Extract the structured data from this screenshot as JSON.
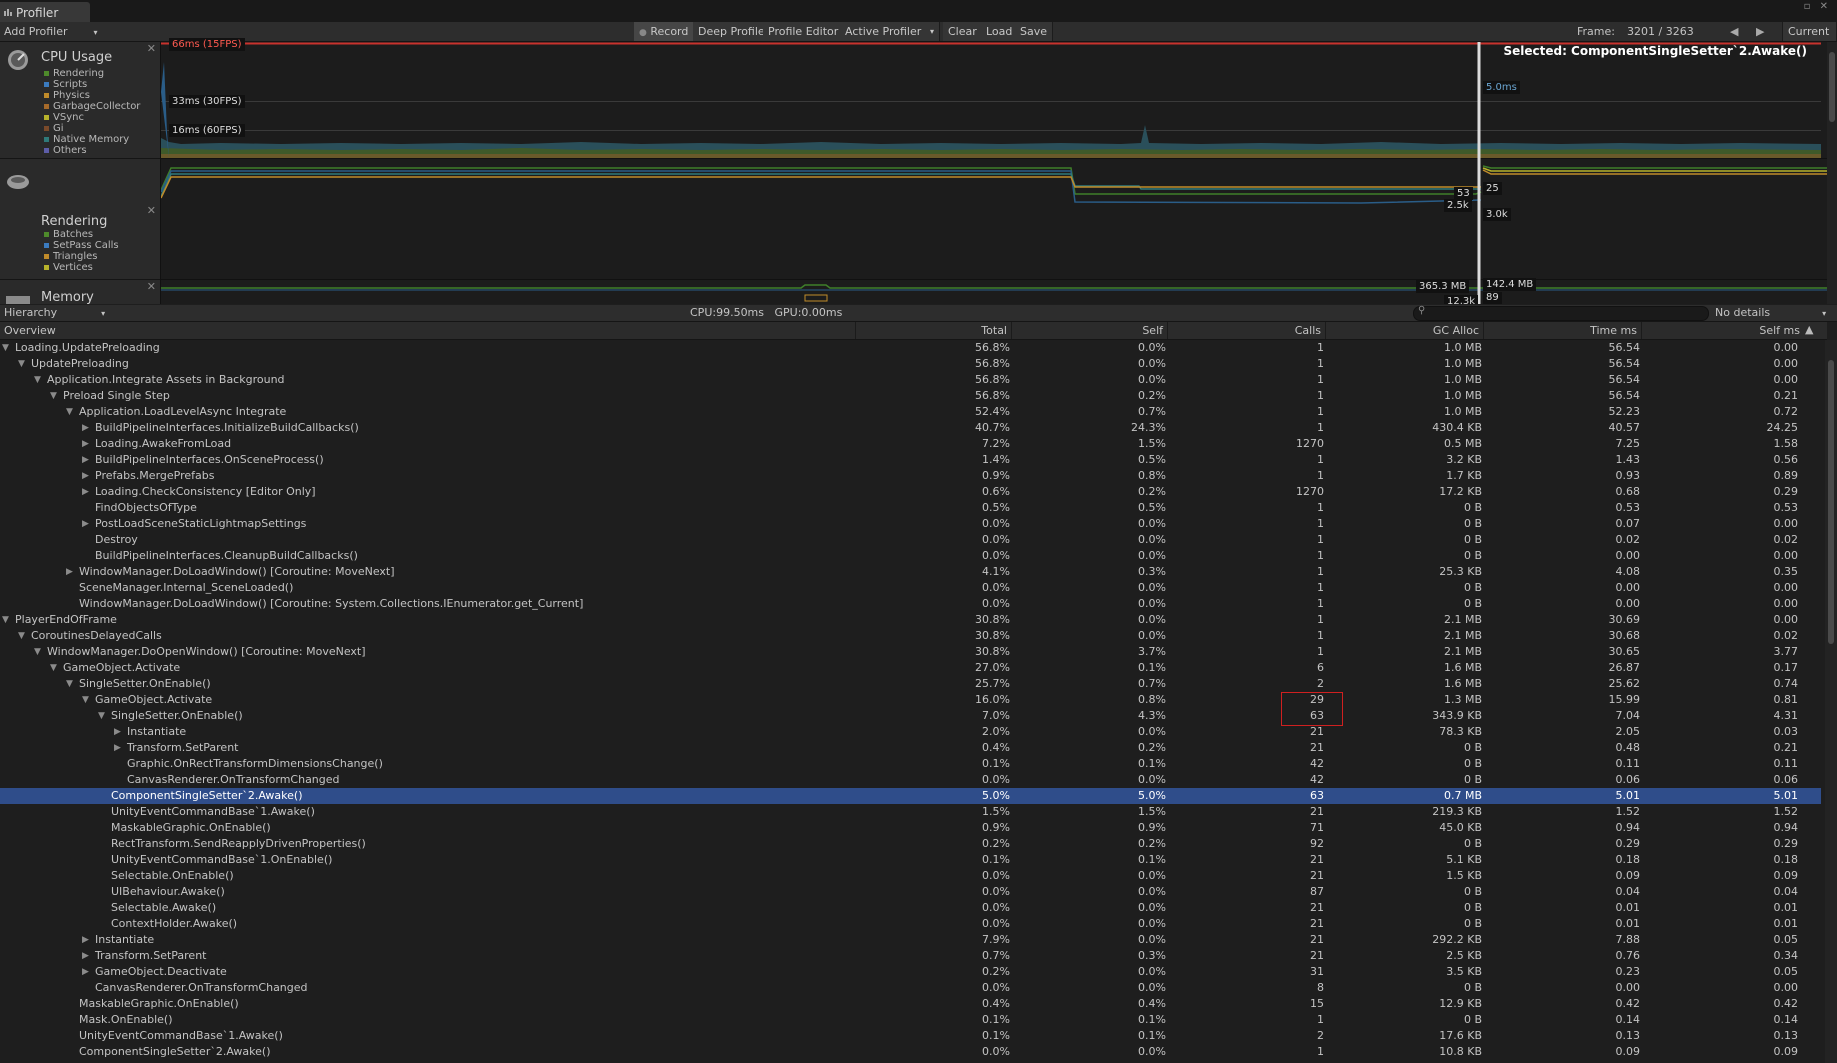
{
  "window": {
    "tab_label": "Profiler",
    "controls": "▫ ✕"
  },
  "toolbar": {
    "add_profiler": "Add Profiler",
    "record": "Record",
    "deep_profile": "Deep Profile",
    "profile_editor": "Profile Editor",
    "active_profiler": "Active Profiler",
    "clear": "Clear",
    "load": "Load",
    "save": "Save",
    "frame_label": "Frame:",
    "frame_value": "3201 / 3263",
    "current": "Current"
  },
  "modules": {
    "cpu": {
      "title": "CPU Usage",
      "legend": [
        {
          "label": "Rendering",
          "color": "#4e8a2b"
        },
        {
          "label": "Scripts",
          "color": "#3b7bbf"
        },
        {
          "label": "Physics",
          "color": "#c08b2a"
        },
        {
          "label": "GarbageCollector",
          "color": "#a66a2a"
        },
        {
          "label": "VSync",
          "color": "#b6b22b"
        },
        {
          "label": "Gi",
          "color": "#7a4a2a"
        },
        {
          "label": "Native Memory",
          "color": "#2f7a7a"
        },
        {
          "label": "Others",
          "color": "#5d5da8"
        }
      ]
    },
    "rendering": {
      "title": "Rendering",
      "legend": [
        {
          "label": "Batches",
          "color": "#4e8a2b"
        },
        {
          "label": "SetPass Calls",
          "color": "#3b7bbf"
        },
        {
          "label": "Triangles",
          "color": "#c08b2a"
        },
        {
          "label": "Vertices",
          "color": "#b6b22b"
        }
      ]
    },
    "memory": {
      "title": "Memory"
    }
  },
  "chart": {
    "selected": "Selected: ComponentSingleSetter`2.Awake()",
    "lines": {
      "l66": "66ms (15FPS)",
      "l33": "33ms (30FPS)",
      "l16": "16ms (60FPS)"
    },
    "cpu_value": "5.0ms",
    "render_53": "53",
    "render_25": "25",
    "render_25k": "2.5k",
    "render_30k": "3.0k",
    "mem_365": "365.3 MB",
    "mem_142": "142.4 MB",
    "mem_89": "89",
    "mem_12k": "12.3k",
    "colors": {
      "red": "#c8322d",
      "green": "#3f7f2a",
      "blue": "#2a5d88"
    }
  },
  "hierarchy_bar": {
    "view": "Hierarchy",
    "stats": "CPU:99.50ms   GPU:0.00ms",
    "details": "No details"
  },
  "columns": {
    "overview": "Overview",
    "total": "Total",
    "self": "Self",
    "calls": "Calls",
    "gc": "GC Alloc",
    "time": "Time ms",
    "selfms": "Self ms"
  },
  "rows": [
    {
      "name": "Loading.UpdatePreloading",
      "d": 0,
      "a": "open",
      "total": "56.8%",
      "self": "0.0%",
      "calls": "1",
      "gc": "1.0 MB",
      "time": "56.54",
      "selfms": "0.00"
    },
    {
      "name": "UpdatePreloading",
      "d": 1,
      "a": "open",
      "total": "56.8%",
      "self": "0.0%",
      "calls": "1",
      "gc": "1.0 MB",
      "time": "56.54",
      "selfms": "0.00"
    },
    {
      "name": "Application.Integrate Assets in Background",
      "d": 2,
      "a": "open",
      "total": "56.8%",
      "self": "0.0%",
      "calls": "1",
      "gc": "1.0 MB",
      "time": "56.54",
      "selfms": "0.00"
    },
    {
      "name": "Preload Single Step",
      "d": 3,
      "a": "open",
      "total": "56.8%",
      "self": "0.2%",
      "calls": "1",
      "gc": "1.0 MB",
      "time": "56.54",
      "selfms": "0.21"
    },
    {
      "name": "Application.LoadLevelAsync Integrate",
      "d": 4,
      "a": "open",
      "total": "52.4%",
      "self": "0.7%",
      "calls": "1",
      "gc": "1.0 MB",
      "time": "52.23",
      "selfms": "0.72"
    },
    {
      "name": "BuildPipelineInterfaces.InitializeBuildCallbacks()",
      "d": 5,
      "a": "closed",
      "total": "40.7%",
      "self": "24.3%",
      "calls": "1",
      "gc": "430.4 KB",
      "time": "40.57",
      "selfms": "24.25"
    },
    {
      "name": "Loading.AwakeFromLoad",
      "d": 5,
      "a": "closed",
      "total": "7.2%",
      "self": "1.5%",
      "calls": "1270",
      "gc": "0.5 MB",
      "time": "7.25",
      "selfms": "1.58"
    },
    {
      "name": "BuildPipelineInterfaces.OnSceneProcess()",
      "d": 5,
      "a": "closed",
      "total": "1.4%",
      "self": "0.5%",
      "calls": "1",
      "gc": "3.2 KB",
      "time": "1.43",
      "selfms": "0.56"
    },
    {
      "name": "Prefabs.MergePrefabs",
      "d": 5,
      "a": "closed",
      "total": "0.9%",
      "self": "0.8%",
      "calls": "1",
      "gc": "1.7 KB",
      "time": "0.93",
      "selfms": "0.89"
    },
    {
      "name": "Loading.CheckConsistency [Editor Only]",
      "d": 5,
      "a": "closed",
      "total": "0.6%",
      "self": "0.2%",
      "calls": "1270",
      "gc": "17.2 KB",
      "time": "0.68",
      "selfms": "0.29"
    },
    {
      "name": "FindObjectsOfType",
      "d": 5,
      "a": "none",
      "total": "0.5%",
      "self": "0.5%",
      "calls": "1",
      "gc": "0 B",
      "time": "0.53",
      "selfms": "0.53"
    },
    {
      "name": "PostLoadSceneStaticLightmapSettings",
      "d": 5,
      "a": "closed",
      "total": "0.0%",
      "self": "0.0%",
      "calls": "1",
      "gc": "0 B",
      "time": "0.07",
      "selfms": "0.00"
    },
    {
      "name": "Destroy",
      "d": 5,
      "a": "none",
      "total": "0.0%",
      "self": "0.0%",
      "calls": "1",
      "gc": "0 B",
      "time": "0.02",
      "selfms": "0.02"
    },
    {
      "name": "BuildPipelineInterfaces.CleanupBuildCallbacks()",
      "d": 5,
      "a": "none",
      "total": "0.0%",
      "self": "0.0%",
      "calls": "1",
      "gc": "0 B",
      "time": "0.00",
      "selfms": "0.00"
    },
    {
      "name": "WindowManager.DoLoadWindow() [Coroutine: MoveNext]",
      "d": 4,
      "a": "closed",
      "total": "4.1%",
      "self": "0.3%",
      "calls": "1",
      "gc": "25.3 KB",
      "time": "4.08",
      "selfms": "0.35"
    },
    {
      "name": "SceneManager.Internal_SceneLoaded()",
      "d": 4,
      "a": "none",
      "total": "0.0%",
      "self": "0.0%",
      "calls": "1",
      "gc": "0 B",
      "time": "0.00",
      "selfms": "0.00"
    },
    {
      "name": "WindowManager.DoLoadWindow() [Coroutine: System.Collections.IEnumerator.get_Current]",
      "d": 4,
      "a": "none",
      "total": "0.0%",
      "self": "0.0%",
      "calls": "1",
      "gc": "0 B",
      "time": "0.00",
      "selfms": "0.00"
    },
    {
      "name": "PlayerEndOfFrame",
      "d": 0,
      "a": "open",
      "total": "30.8%",
      "self": "0.0%",
      "calls": "1",
      "gc": "2.1 MB",
      "time": "30.69",
      "selfms": "0.00"
    },
    {
      "name": "CoroutinesDelayedCalls",
      "d": 1,
      "a": "open",
      "total": "30.8%",
      "self": "0.0%",
      "calls": "1",
      "gc": "2.1 MB",
      "time": "30.68",
      "selfms": "0.02"
    },
    {
      "name": "WindowManager.DoOpenWindow() [Coroutine: MoveNext]",
      "d": 2,
      "a": "open",
      "total": "30.8%",
      "self": "3.7%",
      "calls": "1",
      "gc": "2.1 MB",
      "time": "30.65",
      "selfms": "3.77"
    },
    {
      "name": "GameObject.Activate",
      "d": 3,
      "a": "open",
      "total": "27.0%",
      "self": "0.1%",
      "calls": "6",
      "gc": "1.6 MB",
      "time": "26.87",
      "selfms": "0.17"
    },
    {
      "name": "SingleSetter.OnEnable()",
      "d": 4,
      "a": "open",
      "total": "25.7%",
      "self": "0.7%",
      "calls": "2",
      "gc": "1.6 MB",
      "time": "25.62",
      "selfms": "0.74"
    },
    {
      "name": "GameObject.Activate",
      "d": 5,
      "a": "open",
      "total": "16.0%",
      "self": "0.8%",
      "calls": "29",
      "gc": "1.3 MB",
      "time": "15.99",
      "selfms": "0.81"
    },
    {
      "name": "SingleSetter.OnEnable()",
      "d": 6,
      "a": "open",
      "total": "7.0%",
      "self": "4.3%",
      "calls": "63",
      "gc": "343.9 KB",
      "time": "7.04",
      "selfms": "4.31"
    },
    {
      "name": "Instantiate",
      "d": 7,
      "a": "closed",
      "total": "2.0%",
      "self": "0.0%",
      "calls": "21",
      "gc": "78.3 KB",
      "time": "2.05",
      "selfms": "0.03"
    },
    {
      "name": "Transform.SetParent",
      "d": 7,
      "a": "closed",
      "total": "0.4%",
      "self": "0.2%",
      "calls": "21",
      "gc": "0 B",
      "time": "0.48",
      "selfms": "0.21"
    },
    {
      "name": "Graphic.OnRectTransformDimensionsChange()",
      "d": 7,
      "a": "none",
      "total": "0.1%",
      "self": "0.1%",
      "calls": "42",
      "gc": "0 B",
      "time": "0.11",
      "selfms": "0.11"
    },
    {
      "name": "CanvasRenderer.OnTransformChanged",
      "d": 7,
      "a": "none",
      "total": "0.0%",
      "self": "0.0%",
      "calls": "42",
      "gc": "0 B",
      "time": "0.06",
      "selfms": "0.06"
    },
    {
      "name": "ComponentSingleSetter`2.Awake()",
      "d": 6,
      "a": "none",
      "sel": true,
      "total": "5.0%",
      "self": "5.0%",
      "calls": "63",
      "gc": "0.7 MB",
      "time": "5.01",
      "selfms": "5.01"
    },
    {
      "name": "UnityEventCommandBase`1.Awake()",
      "d": 6,
      "a": "none",
      "total": "1.5%",
      "self": "1.5%",
      "calls": "21",
      "gc": "219.3 KB",
      "time": "1.52",
      "selfms": "1.52"
    },
    {
      "name": "MaskableGraphic.OnEnable()",
      "d": 6,
      "a": "none",
      "total": "0.9%",
      "self": "0.9%",
      "calls": "71",
      "gc": "45.0 KB",
      "time": "0.94",
      "selfms": "0.94"
    },
    {
      "name": "RectTransform.SendReapplyDrivenProperties()",
      "d": 6,
      "a": "none",
      "total": "0.2%",
      "self": "0.2%",
      "calls": "92",
      "gc": "0 B",
      "time": "0.29",
      "selfms": "0.29"
    },
    {
      "name": "UnityEventCommandBase`1.OnEnable()",
      "d": 6,
      "a": "none",
      "total": "0.1%",
      "self": "0.1%",
      "calls": "21",
      "gc": "5.1 KB",
      "time": "0.18",
      "selfms": "0.18"
    },
    {
      "name": "Selectable.OnEnable()",
      "d": 6,
      "a": "none",
      "total": "0.0%",
      "self": "0.0%",
      "calls": "21",
      "gc": "1.5 KB",
      "time": "0.09",
      "selfms": "0.09"
    },
    {
      "name": "UIBehaviour.Awake()",
      "d": 6,
      "a": "none",
      "total": "0.0%",
      "self": "0.0%",
      "calls": "87",
      "gc": "0 B",
      "time": "0.04",
      "selfms": "0.04"
    },
    {
      "name": "Selectable.Awake()",
      "d": 6,
      "a": "none",
      "total": "0.0%",
      "self": "0.0%",
      "calls": "21",
      "gc": "0 B",
      "time": "0.01",
      "selfms": "0.01"
    },
    {
      "name": "ContextHolder.Awake()",
      "d": 6,
      "a": "none",
      "total": "0.0%",
      "self": "0.0%",
      "calls": "21",
      "gc": "0 B",
      "time": "0.01",
      "selfms": "0.01"
    },
    {
      "name": "Instantiate",
      "d": 5,
      "a": "closed",
      "total": "7.9%",
      "self": "0.0%",
      "calls": "21",
      "gc": "292.2 KB",
      "time": "7.88",
      "selfms": "0.05"
    },
    {
      "name": "Transform.SetParent",
      "d": 5,
      "a": "closed",
      "total": "0.7%",
      "self": "0.3%",
      "calls": "21",
      "gc": "2.5 KB",
      "time": "0.76",
      "selfms": "0.34"
    },
    {
      "name": "GameObject.Deactivate",
      "d": 5,
      "a": "closed",
      "total": "0.2%",
      "self": "0.0%",
      "calls": "31",
      "gc": "3.5 KB",
      "time": "0.23",
      "selfms": "0.05"
    },
    {
      "name": "CanvasRenderer.OnTransformChanged",
      "d": 5,
      "a": "none",
      "total": "0.0%",
      "self": "0.0%",
      "calls": "8",
      "gc": "0 B",
      "time": "0.00",
      "selfms": "0.00"
    },
    {
      "name": "MaskableGraphic.OnEnable()",
      "d": 4,
      "a": "none",
      "total": "0.4%",
      "self": "0.4%",
      "calls": "15",
      "gc": "12.9 KB",
      "time": "0.42",
      "selfms": "0.42"
    },
    {
      "name": "Mask.OnEnable()",
      "d": 4,
      "a": "none",
      "total": "0.1%",
      "self": "0.1%",
      "calls": "1",
      "gc": "0 B",
      "time": "0.14",
      "selfms": "0.14"
    },
    {
      "name": "UnityEventCommandBase`1.Awake()",
      "d": 4,
      "a": "none",
      "total": "0.1%",
      "self": "0.1%",
      "calls": "2",
      "gc": "17.6 KB",
      "time": "0.13",
      "selfms": "0.13"
    },
    {
      "name": "ComponentSingleSetter`2.Awake()",
      "d": 4,
      "a": "none",
      "total": "0.0%",
      "self": "0.0%",
      "calls": "1",
      "gc": "10.8 KB",
      "time": "0.09",
      "selfms": "0.09"
    }
  ]
}
